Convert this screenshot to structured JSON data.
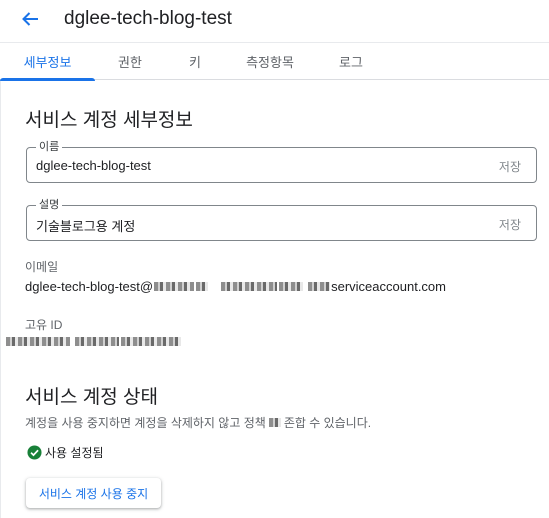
{
  "header": {
    "title": "dglee-tech-blog-test",
    "back_icon": "arrow-back-icon"
  },
  "tabs": [
    {
      "label": "세부정보",
      "active": true
    },
    {
      "label": "권한",
      "active": false
    },
    {
      "label": "키",
      "active": false
    },
    {
      "label": "측정항목",
      "active": false
    },
    {
      "label": "로그",
      "active": false
    }
  ],
  "details": {
    "title": "서비스 계정 세부정보",
    "name_field": {
      "label": "이름",
      "value": "dglee-tech-blog-test",
      "save_label": "저장"
    },
    "description_field": {
      "label": "설명",
      "value": "기술블로그용 계정",
      "save_label": "저장"
    },
    "email": {
      "label": "이메일",
      "prefix": "dglee-tech-blog-test@",
      "suffix": "serviceaccount.com"
    },
    "unique_id": {
      "label": "고유 ID"
    }
  },
  "status_section": {
    "title": "서비스 계정 상태",
    "description_before": "계정을 사용 중지하면 계정을 삭제하지 않고 정책",
    "description_after": "존합 수 있습니다.",
    "status_text": "사용 설정됨",
    "status_icon": "check-circle-icon",
    "disable_button_label": "서비스 계정 사용 중지"
  },
  "colors": {
    "accent": "#1a73e8",
    "status_ok": "#188038"
  }
}
